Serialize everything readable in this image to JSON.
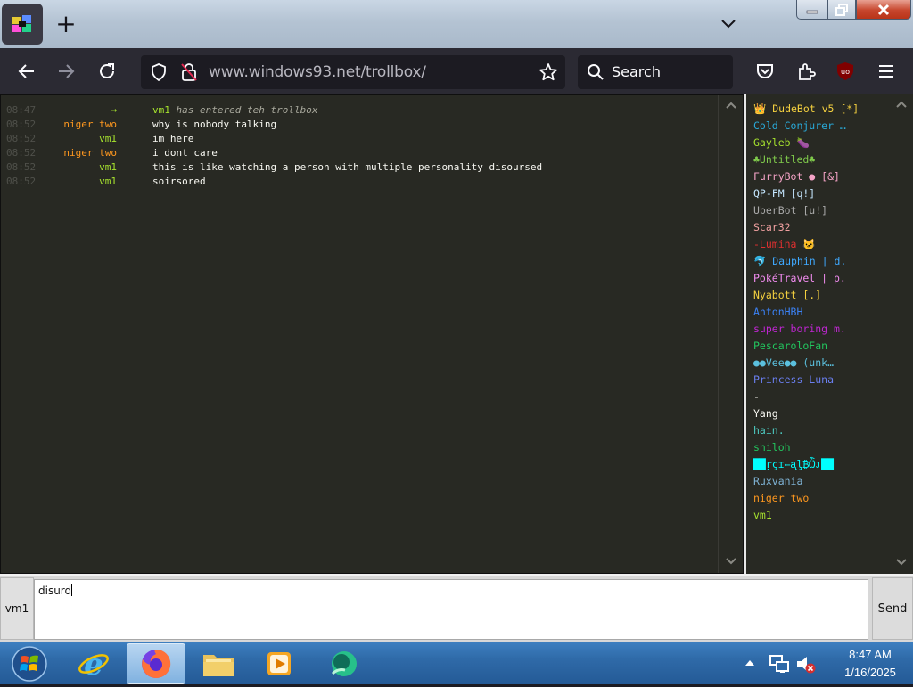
{
  "browser": {
    "url_host": "www.windows93.net",
    "url_path": "/trollbox/",
    "search_placeholder": "Search",
    "ublock_label": "uo"
  },
  "chat": {
    "messages": [
      {
        "time": "08:47",
        "nick": "→",
        "nick_color": "#a6e22e",
        "text": "vm1",
        "sys": " has entered teh trollbox",
        "system": true
      },
      {
        "time": "08:52",
        "nick": "niger two",
        "nick_color": "#fd971f",
        "text": "why is nobody talking"
      },
      {
        "time": "08:52",
        "nick": "vm1",
        "nick_color": "#a6e22e",
        "text": "im here"
      },
      {
        "time": "08:52",
        "nick": "niger two",
        "nick_color": "#fd971f",
        "text": "i dont care"
      },
      {
        "time": "08:52",
        "nick": "vm1",
        "nick_color": "#a6e22e",
        "text": "this is like watching a person with multiple personality disoursed"
      },
      {
        "time": "08:52",
        "nick": "vm1",
        "nick_color": "#a6e22e",
        "text": "soirsored"
      }
    ]
  },
  "users": [
    {
      "name": "👑 DudeBot v5 [*]",
      "color": "#f4d03f"
    },
    {
      "name": "Cold Conjurer …",
      "color": "#29a9d8"
    },
    {
      "name": "Gayleb 🍆",
      "color": "#a6e22e"
    },
    {
      "name": "♣Untitled♣",
      "color": "#7fc94b"
    },
    {
      "name": "FurryBot ● [&]",
      "color": "#f5a3c7"
    },
    {
      "name": "QP-FM [q!]",
      "color": "#c5e7ff"
    },
    {
      "name": "UberBot [u!]",
      "color": "#a8a8a8"
    },
    {
      "name": "Scar32",
      "color": "#f0a0a0"
    },
    {
      "name": "-Lumina 🐱",
      "color": "#e03030"
    },
    {
      "name": "🐬 Dauphin | d.",
      "color": "#3fa9ff"
    },
    {
      "name": "PokéTravel | p.",
      "color": "#f28cf0"
    },
    {
      "name": "Nyabott [.]",
      "color": "#f4d03f"
    },
    {
      "name": "AntonHBH",
      "color": "#3b82f6"
    },
    {
      "name": "super boring m.",
      "color": "#c026d3"
    },
    {
      "name": "PescaroloFan",
      "color": "#22c55e"
    },
    {
      "name": "●●Vee●● (unk…",
      "color": "#5bc0de"
    },
    {
      "name": "Princess Luna",
      "color": "#6a7ff0"
    },
    {
      "name": "-",
      "color": "#f8f8f2"
    },
    {
      "name": "Yang",
      "color": "#f8f8f2"
    },
    {
      "name": "hain.",
      "color": "#4ecdc4"
    },
    {
      "name": "shiloh",
      "color": "#22c55e"
    },
    {
      "name": "██ŗçɪ←ᶏᶅ₿Ѽᴊ██",
      "color": "#00ffff"
    },
    {
      "name": "Ruxvania",
      "color": "#7fb3d5"
    },
    {
      "name": "niger two",
      "color": "#fd971f"
    },
    {
      "name": "vm1",
      "color": "#a6e22e"
    }
  ],
  "input": {
    "nick": "vm1",
    "value": "disurd",
    "send_label": "Send"
  },
  "taskbar": {
    "time": "8:47 AM",
    "date": "1/16/2025"
  }
}
